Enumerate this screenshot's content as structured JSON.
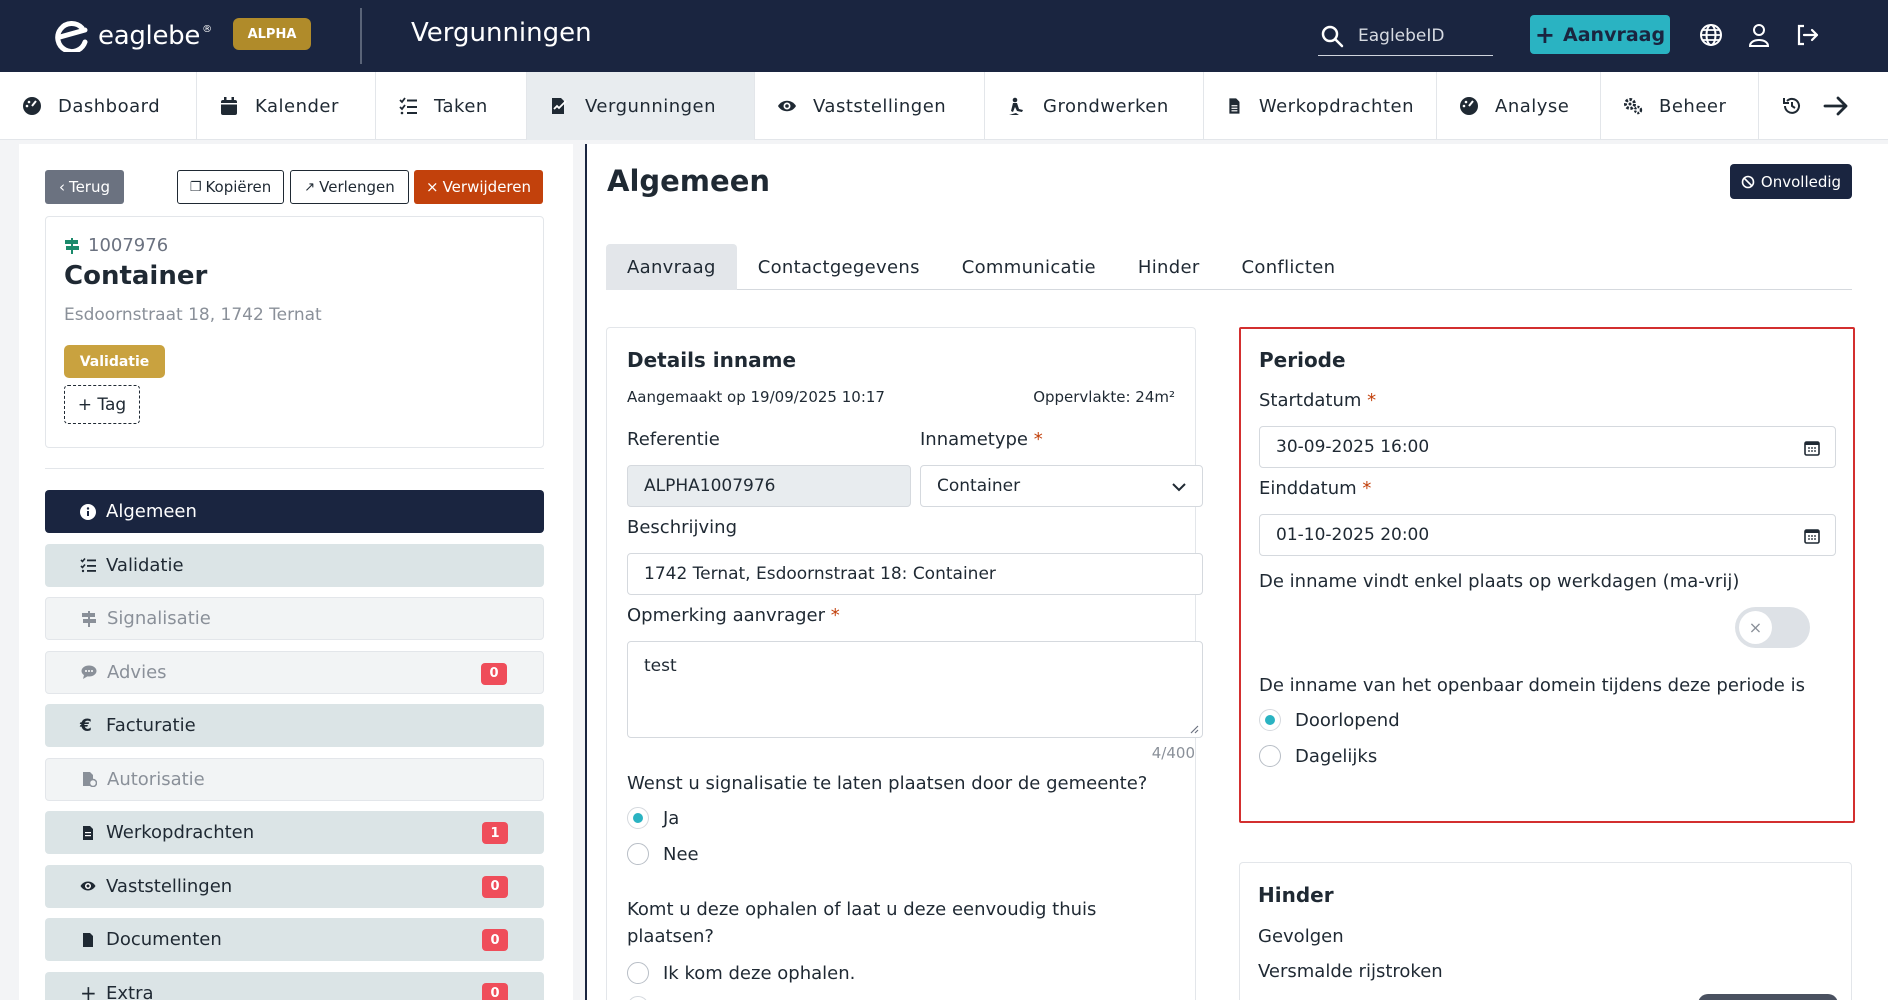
{
  "topbar": {
    "logo_text": "eaglebe",
    "logo_reg": "®",
    "alpha_label": "ALPHA",
    "app_title": "Vergunningen",
    "search_placeholder": "EaglebeID",
    "new_button_label": "Aanvraag"
  },
  "nav": {
    "items": [
      {
        "label": "Dashboard",
        "icon": "dashboard-icon"
      },
      {
        "label": "Kalender",
        "icon": "calendar-icon"
      },
      {
        "label": "Taken",
        "icon": "tasks-icon"
      },
      {
        "label": "Vergunningen",
        "icon": "permit-icon"
      },
      {
        "label": "Vaststellingen",
        "icon": "eye-icon"
      },
      {
        "label": "Grondwerken",
        "icon": "digging-icon"
      },
      {
        "label": "Werkopdrachten",
        "icon": "file-icon"
      },
      {
        "label": "Analyse",
        "icon": "dashboard-icon"
      },
      {
        "label": "Beheer",
        "icon": "gears-icon"
      }
    ]
  },
  "sidebar": {
    "back_label": "Terug",
    "copy_label": "Kopiëren",
    "extend_label": "Verlengen",
    "delete_label": "Verwijderen",
    "card": {
      "id": "1007976",
      "title": "Container",
      "address": "Esdoornstraat 18, 1742 Ternat",
      "status_badge": "Validatie",
      "tag_button": "+ Tag"
    },
    "menu": [
      {
        "label": "Algemeen",
        "icon": "info-icon",
        "count": ""
      },
      {
        "label": "Validatie",
        "icon": "checklist-icon",
        "count": ""
      },
      {
        "label": "Signalisatie",
        "icon": "signpost-icon",
        "count": ""
      },
      {
        "label": "Advies",
        "icon": "comments-icon",
        "count": "0"
      },
      {
        "label": "Facturatie",
        "icon": "euro-icon",
        "count": ""
      },
      {
        "label": "Autorisatie",
        "icon": "file-signature-icon",
        "count": ""
      },
      {
        "label": "Werkopdrachten",
        "icon": "file-icon",
        "count": "1"
      },
      {
        "label": "Vaststellingen",
        "icon": "eye-icon",
        "count": "0"
      },
      {
        "label": "Documenten",
        "icon": "file-icon",
        "count": "0"
      },
      {
        "label": "Extra",
        "icon": "plus-icon",
        "count": "0"
      }
    ]
  },
  "main": {
    "title": "Algemeen",
    "status_label": "Onvolledig",
    "tabs": [
      "Aanvraag",
      "Contactgegevens",
      "Communicatie",
      "Hinder",
      "Conflicten"
    ]
  },
  "details": {
    "title": "Details inname",
    "created": "Aangemaakt op 19/09/2025 10:17",
    "area": "Oppervlakte: 24m²",
    "reference_label": "Referentie",
    "reference_value": "ALPHA1007976",
    "type_label": "Innametype",
    "type_value": "Container",
    "description_label": "Beschrijving",
    "description_value": "1742 Ternat, Esdoornstraat 18: Container",
    "remark_label": "Opmerking aanvrager",
    "remark_value": "test",
    "remark_counter": "4/400",
    "signalisatie_question": "Wenst u signalisatie te laten plaatsen door de gemeente?",
    "signalisatie_yes": "Ja",
    "signalisatie_no": "Nee",
    "pickup_question": "Komt u deze ophalen of laat u deze eenvoudig thuis plaatsen?",
    "pickup_option_1": "Ik kom deze ophalen."
  },
  "periode": {
    "title": "Periode",
    "start_label": "Startdatum",
    "start_value": "30-09-2025 16:00",
    "end_label": "Einddatum",
    "end_value": "01-10-2025 20:00",
    "weekdays_label": "De inname vindt enkel plaats op werkdagen (ma-vrij)",
    "weekdays_on": false,
    "occupancy_label": "De inname van het openbaar domein tijdens deze periode is",
    "option_continuous": "Doorlopend",
    "option_daily": "Dagelijks",
    "highlight_color": "#d32f2f"
  },
  "hinder": {
    "title": "Hinder",
    "consequences_label": "Gevolgen",
    "item_1": "Versmalde rijstroken"
  },
  "colors": {
    "navy": "#1a2540",
    "teal": "#2ab3c2",
    "alpha_gold": "#b08b2a",
    "delete_red": "#c2410c",
    "count_red": "#ef4d5a"
  }
}
